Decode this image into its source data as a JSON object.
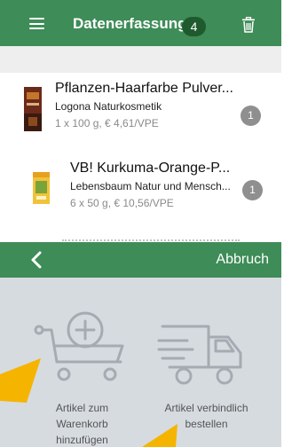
{
  "header": {
    "title": "Datenerfassung",
    "count": "4"
  },
  "items": [
    {
      "title": "Pflanzen-Haarfarbe Pulver...",
      "brand": "Logona Naturkosmetik",
      "detail": "1 x 100 g, € 4,61/VPE",
      "qty": "1"
    },
    {
      "title": "VB! Kurkuma-Orange-P...",
      "brand": "Lebensbaum Natur und Mensch...",
      "detail": "6 x 50 g, € 10,56/VPE",
      "qty": "1"
    }
  ],
  "dialog": {
    "cancel": "Abbruch",
    "add_to_cart_line1": "Artikel zum",
    "add_to_cart_line2": "Warenkorb",
    "add_to_cart_line3": "hinzufügen",
    "order_line1": "Artikel verbindlich",
    "order_line2": "bestellen"
  },
  "colors": {
    "brand_green": "#3e8c57",
    "badge_dark_green": "#1f5a2f",
    "dialog_bg": "#d6dbe0",
    "pointer_yellow": "#f5b400"
  }
}
